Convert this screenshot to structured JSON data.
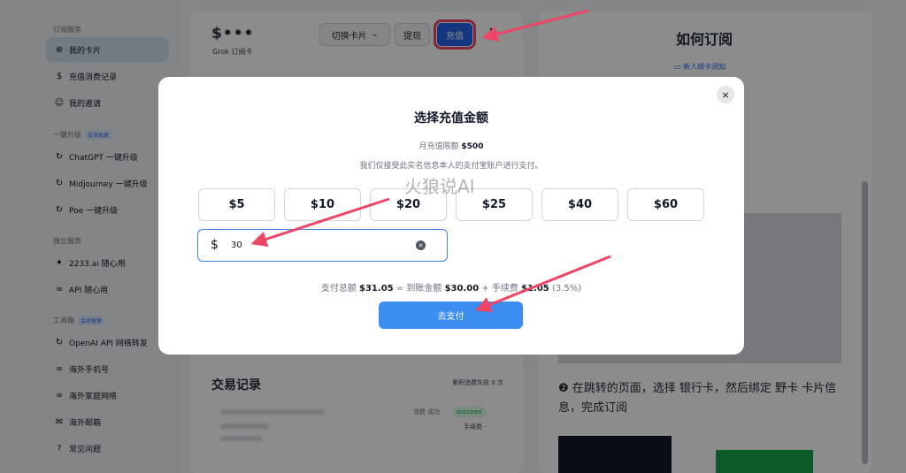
{
  "sidebar": {
    "sections": [
      {
        "label": "订阅服务"
      },
      {
        "label": "一键升级",
        "badge": "会员独享"
      },
      {
        "label": "独立服务"
      },
      {
        "label": "工具箱",
        "badge": "会员独享"
      }
    ],
    "items": [
      {
        "label": "我的卡片",
        "icon": "card-icon",
        "active": true
      },
      {
        "label": "充值消费记录",
        "icon": "dollar-icon"
      },
      {
        "label": "我的邀请",
        "icon": "users-icon"
      },
      {
        "label": "ChatGPT 一键升级",
        "icon": "refresh-icon"
      },
      {
        "label": "Midjourney 一键升级",
        "icon": "refresh-icon"
      },
      {
        "label": "Poe 一键升级",
        "icon": "refresh-icon"
      },
      {
        "label": "2233.ai 随心用",
        "icon": "sparkle-icon"
      },
      {
        "label": "API 随心用",
        "icon": "link-icon"
      },
      {
        "label": "OpenAI API 网络转发",
        "icon": "refresh-icon"
      },
      {
        "label": "海外手机号",
        "icon": "link-icon"
      },
      {
        "label": "海外家庭网络",
        "icon": "link-icon"
      },
      {
        "label": "海外邮箱",
        "icon": "mail-icon"
      },
      {
        "label": "常见问题",
        "icon": "question-icon"
      }
    ]
  },
  "card": {
    "balance": "$•••",
    "subtitle": "Grok 订阅卡",
    "switch_label": "切换卡片",
    "withdraw_label": "提现",
    "recharge_label": "充值",
    "more_label": "⋮"
  },
  "transactions": {
    "title": "交易记录",
    "failed_count": "累积消费失败 0 次",
    "row": {
      "type": "消费",
      "result": "成功",
      "status": "succeed",
      "fee": "手续费 -"
    }
  },
  "guide": {
    "title": "如何订阅",
    "link": "新人绑卡须知",
    "step2": "❷ 在跳转的页面，选择 银行卡，然后绑定 野卡 卡片信息，完成订阅"
  },
  "modal": {
    "title": "选择充值金额",
    "limit_label": "月充值限额",
    "limit_value": "$500",
    "note": "我们仅接受此实名信息本人的支付宝账户进行支付。",
    "amounts": [
      "$5",
      "$10",
      "$20",
      "$25",
      "$40",
      "$60"
    ],
    "currency_symbol": "$",
    "input_value": "30",
    "watermark": "火狼说AI",
    "summary": {
      "total_label": "支付总额",
      "total": "$31.05",
      "eq": "=",
      "received_label": "到账金额",
      "received": "$30.00",
      "plus": "+",
      "fee_label": "手续费",
      "fee": "$1.05",
      "fee_rate": "(3.5%)"
    },
    "pay_label": "去支付",
    "close_label": "×"
  },
  "colors": {
    "primary": "#3b8ef0",
    "annotation": "#ef4565"
  }
}
